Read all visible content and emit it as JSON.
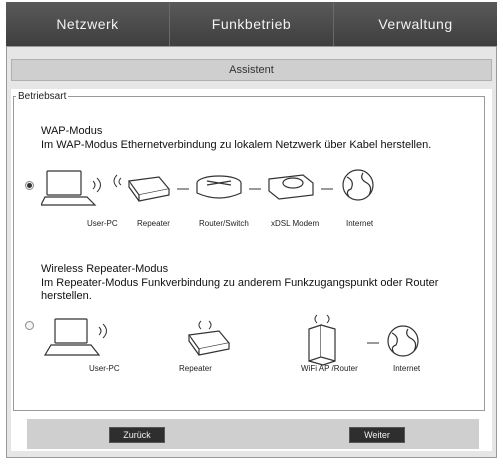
{
  "tabs": [
    "Netzwerk",
    "Funkbetrieb",
    "Verwaltung"
  ],
  "assistant_label": "Assistent",
  "group_legend": "Betriebsart",
  "wap": {
    "title": "WAP-Modus",
    "description": "Im WAP-Modus Ethernetverbindung zu lokalem Netzwerk über Kabel herstellen.",
    "selected": true,
    "devices": [
      "User-PC",
      "Repeater",
      "Router/Switch",
      "xDSL Modem",
      "Internet"
    ]
  },
  "repeater": {
    "title": "Wireless Repeater-Modus",
    "description": "Im Repeater-Modus Funkverbindung zu anderem Funkzugangspunkt oder Router herstellen.",
    "selected": false,
    "devices": [
      "User-PC",
      "Repeater",
      "WiFi AP /Router",
      "Internet"
    ]
  },
  "buttons": {
    "back": "Zurück",
    "next": "Weiter"
  }
}
